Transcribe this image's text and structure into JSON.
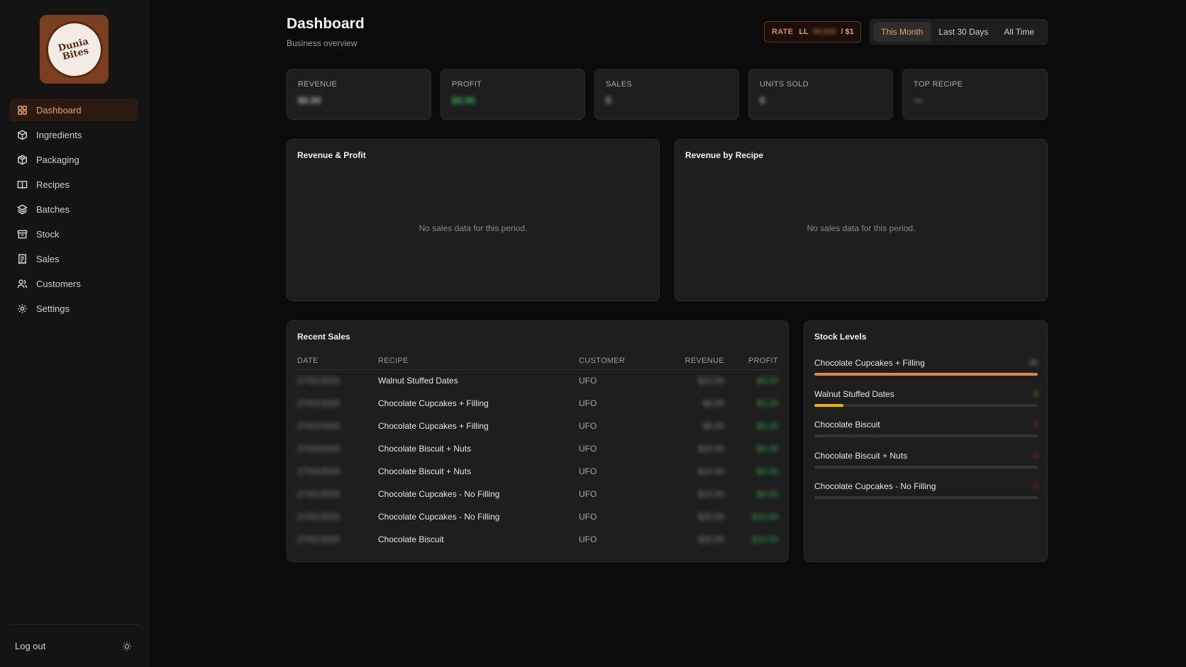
{
  "brand": {
    "logo_line1": "Dunia",
    "logo_line2": "Bites"
  },
  "sidebar": {
    "items": [
      {
        "label": "Dashboard",
        "icon": "grid-icon",
        "active": true
      },
      {
        "label": "Ingredients",
        "icon": "box-icon"
      },
      {
        "label": "Packaging",
        "icon": "package-icon"
      },
      {
        "label": "Recipes",
        "icon": "book-icon"
      },
      {
        "label": "Batches",
        "icon": "layers-icon"
      },
      {
        "label": "Stock",
        "icon": "archive-icon"
      },
      {
        "label": "Sales",
        "icon": "receipt-icon"
      },
      {
        "label": "Customers",
        "icon": "users-icon"
      },
      {
        "label": "Settings",
        "icon": "gear-icon"
      }
    ],
    "logout_label": "Log out"
  },
  "header": {
    "title": "Dashboard",
    "subtitle": "Business overview"
  },
  "rate": {
    "label": "RATE",
    "currency": "LL",
    "value": "89,500",
    "per": "/ $1"
  },
  "period": {
    "options": [
      "This Month",
      "Last 30 Days",
      "All Time"
    ],
    "selected": "This Month"
  },
  "stats": [
    {
      "label": "REVENUE",
      "value": "$0.00"
    },
    {
      "label": "PROFIT",
      "value": "$0.00"
    },
    {
      "label": "SALES",
      "value": "0"
    },
    {
      "label": "UNITS SOLD",
      "value": "0"
    },
    {
      "label": "TOP RECIPE",
      "value": "—"
    }
  ],
  "charts": {
    "revenue_profit": {
      "title": "Revenue & Profit",
      "empty": "No sales data for this period."
    },
    "revenue_recipe": {
      "title": "Revenue by Recipe",
      "empty": "No sales data for this period."
    }
  },
  "recent_sales": {
    "title": "Recent Sales",
    "columns": [
      "DATE",
      "RECIPE",
      "CUSTOMER",
      "REVENUE",
      "PROFIT"
    ],
    "rows": [
      {
        "date": "27/02/2025",
        "recipe": "Walnut Stuffed Dates",
        "customer": "UFO",
        "revenue": "$10.00",
        "profit": "$4.50"
      },
      {
        "date": "27/02/2025",
        "recipe": "Chocolate Cupcakes + Filling",
        "customer": "UFO",
        "revenue": "$8.00",
        "profit": "$3.20"
      },
      {
        "date": "27/02/2025",
        "recipe": "Chocolate Cupcakes + Filling",
        "customer": "UFO",
        "revenue": "$8.00",
        "profit": "$3.20"
      },
      {
        "date": "27/02/2025",
        "recipe": "Chocolate Biscuit + Nuts",
        "customer": "UFO",
        "revenue": "$10.00",
        "profit": "$4.00"
      },
      {
        "date": "27/02/2025",
        "recipe": "Chocolate Biscuit + Nuts",
        "customer": "UFO",
        "revenue": "$10.00",
        "profit": "$4.00"
      },
      {
        "date": "27/02/2025",
        "recipe": "Chocolate Cupcakes - No Filling",
        "customer": "UFO",
        "revenue": "$10.00",
        "profit": "$4.00"
      },
      {
        "date": "27/02/2025",
        "recipe": "Chocolate Cupcakes - No Filling",
        "customer": "UFO",
        "revenue": "$20.00",
        "profit": "$10.00"
      },
      {
        "date": "27/02/2025",
        "recipe": "Chocolate Biscuit",
        "customer": "UFO",
        "revenue": "$20.00",
        "profit": "$10.00"
      }
    ]
  },
  "stock_levels": {
    "title": "Stock Levels",
    "items": [
      {
        "name": "Chocolate Cupcakes + Filling",
        "qty": "36",
        "fill": 1.0,
        "color": "#d9874f",
        "qty_color": "#9a9a9a"
      },
      {
        "name": "Walnut Stuffed Dates",
        "qty": "4",
        "fill": 0.13,
        "color": "#e6b800",
        "qty_color": "#c9a200"
      },
      {
        "name": "Chocolate Biscuit",
        "qty": "0",
        "fill": 0,
        "color": "#d9534f",
        "qty_color": "#c0392b"
      },
      {
        "name": "Chocolate Biscuit + Nuts",
        "qty": "0",
        "fill": 0,
        "color": "#d9534f",
        "qty_color": "#c0392b"
      },
      {
        "name": "Chocolate Cupcakes - No Filling",
        "qty": "0",
        "fill": 0,
        "color": "#d9534f",
        "qty_color": "#c0392b"
      }
    ]
  },
  "colors": {
    "accent": "#e8a06a",
    "profit_green": "#34c759",
    "bg": "#0b0b0b",
    "card": "#1e1e1e"
  }
}
